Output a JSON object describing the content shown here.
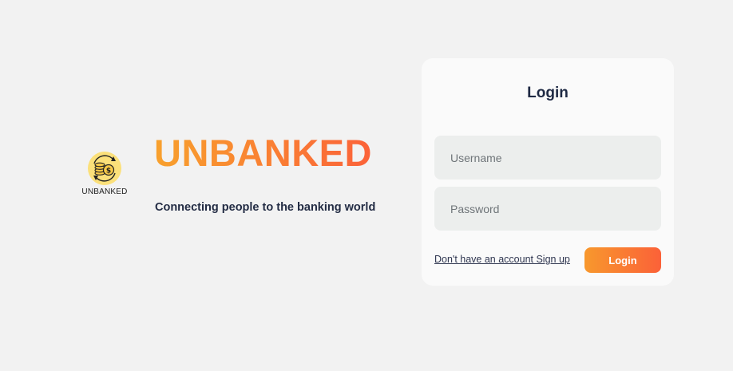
{
  "brand": {
    "logo_caption": "UNBANKED",
    "logo_icon": "coin-stack-cycle-icon",
    "title": "UNBANKED",
    "tagline": "Connecting people to the banking world",
    "colors": {
      "gradient_start": "#f8a12d",
      "gradient_end": "#fb6239",
      "logo_circle": "#fbe07a"
    }
  },
  "login": {
    "title": "Login",
    "username_placeholder": "Username",
    "password_placeholder": "Password",
    "signup_link": "Don't have an account Sign up",
    "login_button": "Login"
  }
}
